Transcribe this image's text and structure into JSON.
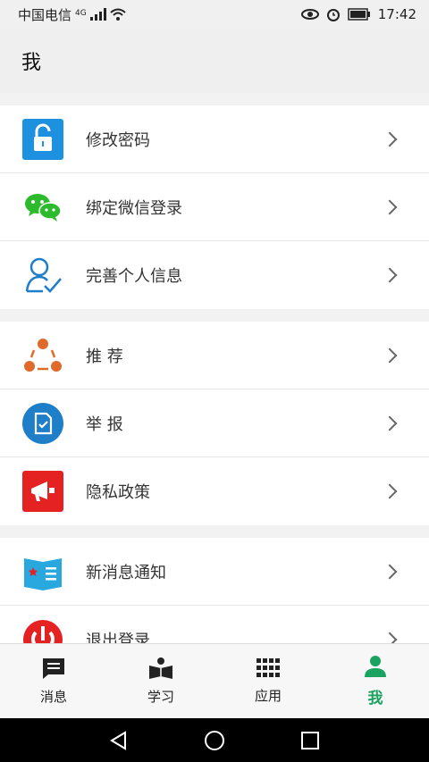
{
  "status_bar": {
    "carrier": "中国电信",
    "network": "4G",
    "time": "17:42"
  },
  "header": {
    "title": "我"
  },
  "groups": [
    {
      "items": [
        {
          "label": "修改密码",
          "icon": "unlock-icon"
        },
        {
          "label": "绑定微信登录",
          "icon": "wechat-icon"
        },
        {
          "label": "完善个人信息",
          "icon": "person-check-icon"
        }
      ]
    },
    {
      "items": [
        {
          "label": "推 荐",
          "icon": "share-network-icon"
        },
        {
          "label": "举 报",
          "icon": "report-document-icon"
        },
        {
          "label": "隐私政策",
          "icon": "megaphone-icon"
        }
      ]
    },
    {
      "items": [
        {
          "label": "新消息通知",
          "icon": "notification-book-icon"
        },
        {
          "label": "退出登录",
          "icon": "power-icon"
        }
      ]
    }
  ],
  "tabs": [
    {
      "label": "消息",
      "icon": "message-icon",
      "active": false
    },
    {
      "label": "学习",
      "icon": "study-book-icon",
      "active": false
    },
    {
      "label": "应用",
      "icon": "apps-grid-icon",
      "active": false
    },
    {
      "label": "我",
      "icon": "person-icon",
      "active": true
    }
  ],
  "colors": {
    "accent": "#1aa260",
    "active_tab": "#1aa260"
  }
}
